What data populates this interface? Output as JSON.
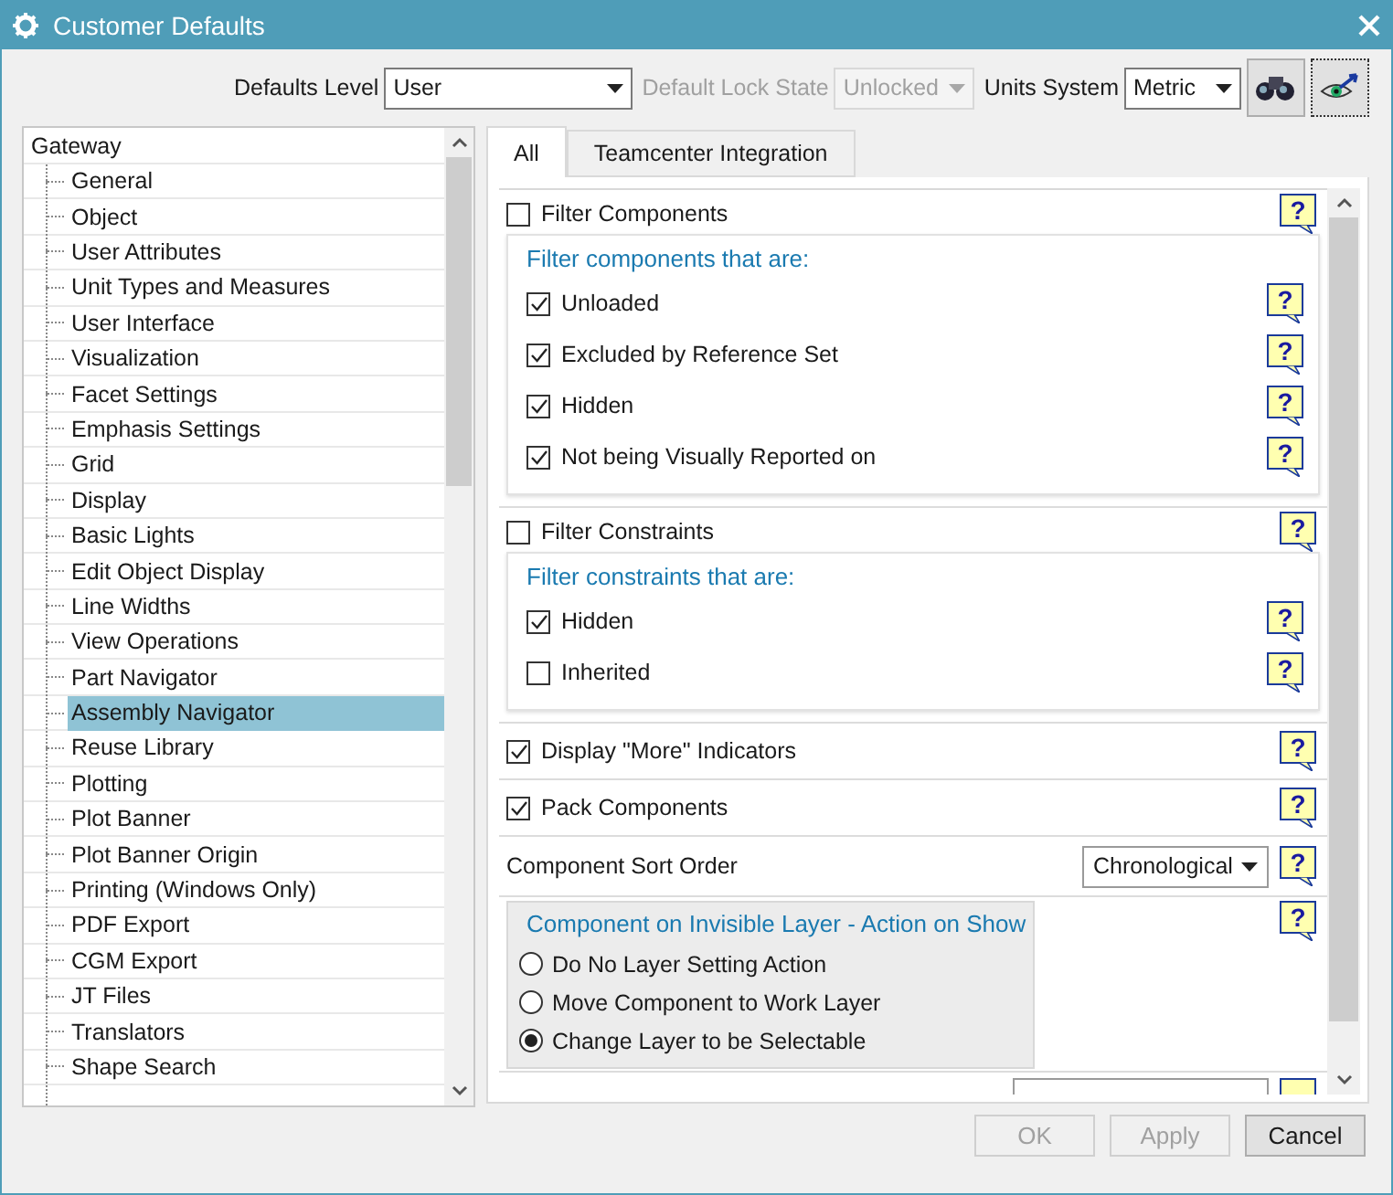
{
  "window": {
    "title": "Customer Defaults"
  },
  "toolbar": {
    "defaults_level": {
      "label": "Defaults Level",
      "value": "User"
    },
    "lock_state": {
      "label": "Default Lock State",
      "value": "Unlocked",
      "disabled": true
    },
    "units_system": {
      "label": "Units System",
      "value": "Metric"
    }
  },
  "tree": {
    "label": "Gateway",
    "children": [
      {
        "label": "General",
        "selected": false
      },
      {
        "label": "Object",
        "selected": false
      },
      {
        "label": "User Attributes",
        "selected": false
      },
      {
        "label": "Unit Types and Measures",
        "selected": false
      },
      {
        "label": "User Interface",
        "selected": false
      },
      {
        "label": "Visualization",
        "selected": false
      },
      {
        "label": "Facet Settings",
        "selected": false
      },
      {
        "label": "Emphasis Settings",
        "selected": false
      },
      {
        "label": "Grid",
        "selected": false
      },
      {
        "label": "Display",
        "selected": false
      },
      {
        "label": "Basic Lights",
        "selected": false
      },
      {
        "label": "Edit Object Display",
        "selected": false
      },
      {
        "label": "Line Widths",
        "selected": false
      },
      {
        "label": "View Operations",
        "selected": false
      },
      {
        "label": "Part Navigator",
        "selected": false
      },
      {
        "label": "Assembly Navigator",
        "selected": true
      },
      {
        "label": "Reuse Library",
        "selected": false
      },
      {
        "label": "Plotting",
        "selected": false
      },
      {
        "label": "Plot Banner",
        "selected": false
      },
      {
        "label": "Plot Banner Origin",
        "selected": false
      },
      {
        "label": "Printing (Windows Only)",
        "selected": false
      },
      {
        "label": "PDF Export",
        "selected": false
      },
      {
        "label": "CGM Export",
        "selected": false
      },
      {
        "label": "JT Files",
        "selected": false
      },
      {
        "label": "Translators",
        "selected": false
      },
      {
        "label": "Shape Search",
        "selected": false
      }
    ]
  },
  "tabs": [
    {
      "label": "All",
      "selected": true
    },
    {
      "label": "Teamcenter Integration",
      "selected": false
    }
  ],
  "sections": [
    {
      "kind": "filter",
      "label": "Filter Components",
      "checked": false,
      "help": "?",
      "heading": "Filter components that are:",
      "options": [
        {
          "label": "Unloaded",
          "checked": true,
          "help": "?"
        },
        {
          "label": "Excluded by Reference Set",
          "checked": true,
          "help": "?"
        },
        {
          "label": "Hidden",
          "checked": true,
          "help": "?"
        },
        {
          "label": "Not being Visually Reported on",
          "checked": true,
          "help": "?"
        }
      ]
    },
    {
      "kind": "filter",
      "label": "Filter Constraints",
      "checked": false,
      "help": "?",
      "heading": "Filter constraints that are:",
      "options": [
        {
          "label": "Hidden",
          "checked": true,
          "help": "?"
        },
        {
          "label": "Inherited",
          "checked": false,
          "help": "?"
        }
      ]
    },
    {
      "kind": "checkbox",
      "label": "Display \"More\" Indicators",
      "checked": true,
      "help": "?"
    },
    {
      "kind": "checkbox",
      "label": "Pack Components",
      "checked": true,
      "help": "?"
    },
    {
      "kind": "dropdown",
      "label": "Component Sort Order",
      "value": "Chronological",
      "help": "?"
    },
    {
      "kind": "radio_group",
      "heading": "Component on Invisible Layer - Action on Show",
      "help": "?",
      "options": [
        {
          "label": "Do No Layer Setting Action",
          "selected": false
        },
        {
          "label": "Move Component to Work Layer",
          "selected": false
        },
        {
          "label": "Change Layer to be Selectable",
          "selected": true
        }
      ]
    },
    {
      "kind": "cut_off"
    }
  ],
  "buttons": [
    {
      "label": "OK",
      "disabled": true
    },
    {
      "label": "Apply",
      "disabled": true
    },
    {
      "label": "Cancel",
      "disabled": false
    }
  ]
}
